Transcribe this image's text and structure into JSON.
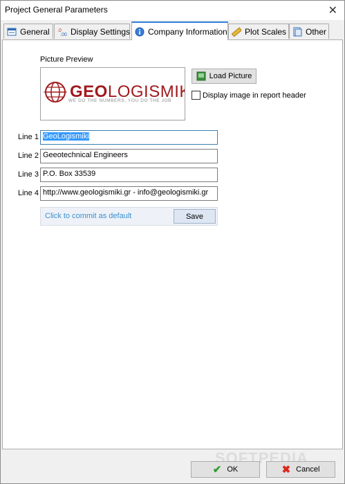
{
  "window": {
    "title": "Project General Parameters"
  },
  "tabs": [
    {
      "label": "General",
      "icon": "general-icon"
    },
    {
      "label": "Display Settings",
      "icon": "display-settings-icon"
    },
    {
      "label": "Company Information",
      "icon": "info-icon",
      "active": true
    },
    {
      "label": "Plot Scales",
      "icon": "ruler-icon"
    },
    {
      "label": "Other",
      "icon": "other-icon"
    }
  ],
  "picture": {
    "preview_label": "Picture Preview",
    "load_button": "Load Picture",
    "display_in_header_label": "Display image in report header",
    "display_in_header_checked": false,
    "logo_text_prefix": "GEO",
    "logo_text_suffix": "LOGISMIKI",
    "logo_tagline": "WE DO THE NUMBERS, YOU DO THE JOB"
  },
  "lines": [
    {
      "label": "Line 1",
      "value": "GeoLogismiki"
    },
    {
      "label": "Line 2",
      "value": "Geeotechnical Engineers"
    },
    {
      "label": "Line 3",
      "value": "P.O. Box 33539"
    },
    {
      "label": "Line 4",
      "value": "http://www.geologismiki.gr - info@geologismiki.gr"
    }
  ],
  "commit": {
    "text": "Click to commit as default",
    "save": "Save"
  },
  "footer": {
    "ok": "OK",
    "cancel": "Cancel",
    "watermark": "SOFTPEDIA"
  },
  "colors": {
    "accent": "#2f7ed8",
    "logo": "#a01a1f",
    "commit_text": "#3a8fd0",
    "ok_check": "#2e9d2e",
    "cancel_x": "#d9281b"
  }
}
